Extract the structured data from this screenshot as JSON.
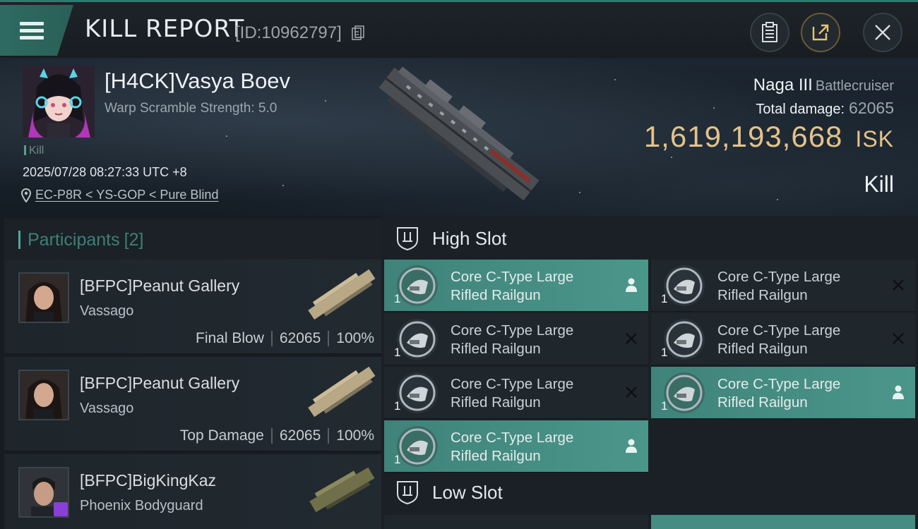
{
  "header": {
    "title": "KILL REPORT",
    "report_id": "[ID:10962797]"
  },
  "victim": {
    "name": "[H4CK]Vasya Boev",
    "subtitle": "Warp Scramble Strength: 5.0",
    "tag": "Kill",
    "timestamp": "2025/07/28 08:27:33 UTC +8",
    "location": "EC-P8R < YS-GOP < Pure Blind",
    "ship_name": "Naga III",
    "ship_class": "Battlecruiser",
    "total_damage_label": "Total damage:",
    "total_damage": "62065",
    "isk_value": "1,619,193,668",
    "isk_unit": "ISK",
    "result": "Kill"
  },
  "participants": {
    "label": "Participants",
    "count": "[2]",
    "items": [
      {
        "name": "[BFPC]Peanut Gallery",
        "ship": "Vassago",
        "role": "Final Blow",
        "damage": "62065",
        "percent": "100%"
      },
      {
        "name": "[BFPC]Peanut Gallery",
        "ship": "Vassago",
        "role": "Top Damage",
        "damage": "62065",
        "percent": "100%"
      },
      {
        "name": "[BFPC]BigKingKaz",
        "ship": "Phoenix Bodyguard"
      }
    ]
  },
  "slots": {
    "high_label": "High Slot",
    "low_label": "Low Slot",
    "modules": [
      {
        "name_line1": "Core C-Type Large",
        "name_line2": "Rifled Railgun",
        "qty": "1",
        "status": "dropped"
      },
      {
        "name_line1": "Core C-Type Large",
        "name_line2": "Rifled Railgun",
        "qty": "1",
        "status": "destroyed"
      },
      {
        "name_line1": "Core C-Type Large",
        "name_line2": "Rifled Railgun",
        "qty": "1",
        "status": "destroyed"
      },
      {
        "name_line1": "Core C-Type Large",
        "name_line2": "Rifled Railgun",
        "qty": "1",
        "status": "destroyed"
      },
      {
        "name_line1": "Core C-Type Large",
        "name_line2": "Rifled Railgun",
        "qty": "1",
        "status": "destroyed"
      },
      {
        "name_line1": "Core C-Type Large",
        "name_line2": "Rifled Railgun",
        "qty": "1",
        "status": "dropped"
      },
      {
        "name_line1": "Core C-Type Large",
        "name_line2": "Rifled Railgun",
        "qty": "1",
        "status": "dropped"
      }
    ]
  },
  "icons": {
    "menu": "hamburger-menu-icon",
    "copy": "copy-icon",
    "clipboard": "clipboard-icon",
    "share": "share-icon",
    "close": "close-icon",
    "location": "location-pin-icon",
    "slot": "slot-shield-icon",
    "dropped": "person-icon",
    "destroyed": "x-icon"
  },
  "colors": {
    "accent": "#4fa9a0",
    "dropped_bg": "#458c82",
    "isk": "#e3c38a"
  }
}
